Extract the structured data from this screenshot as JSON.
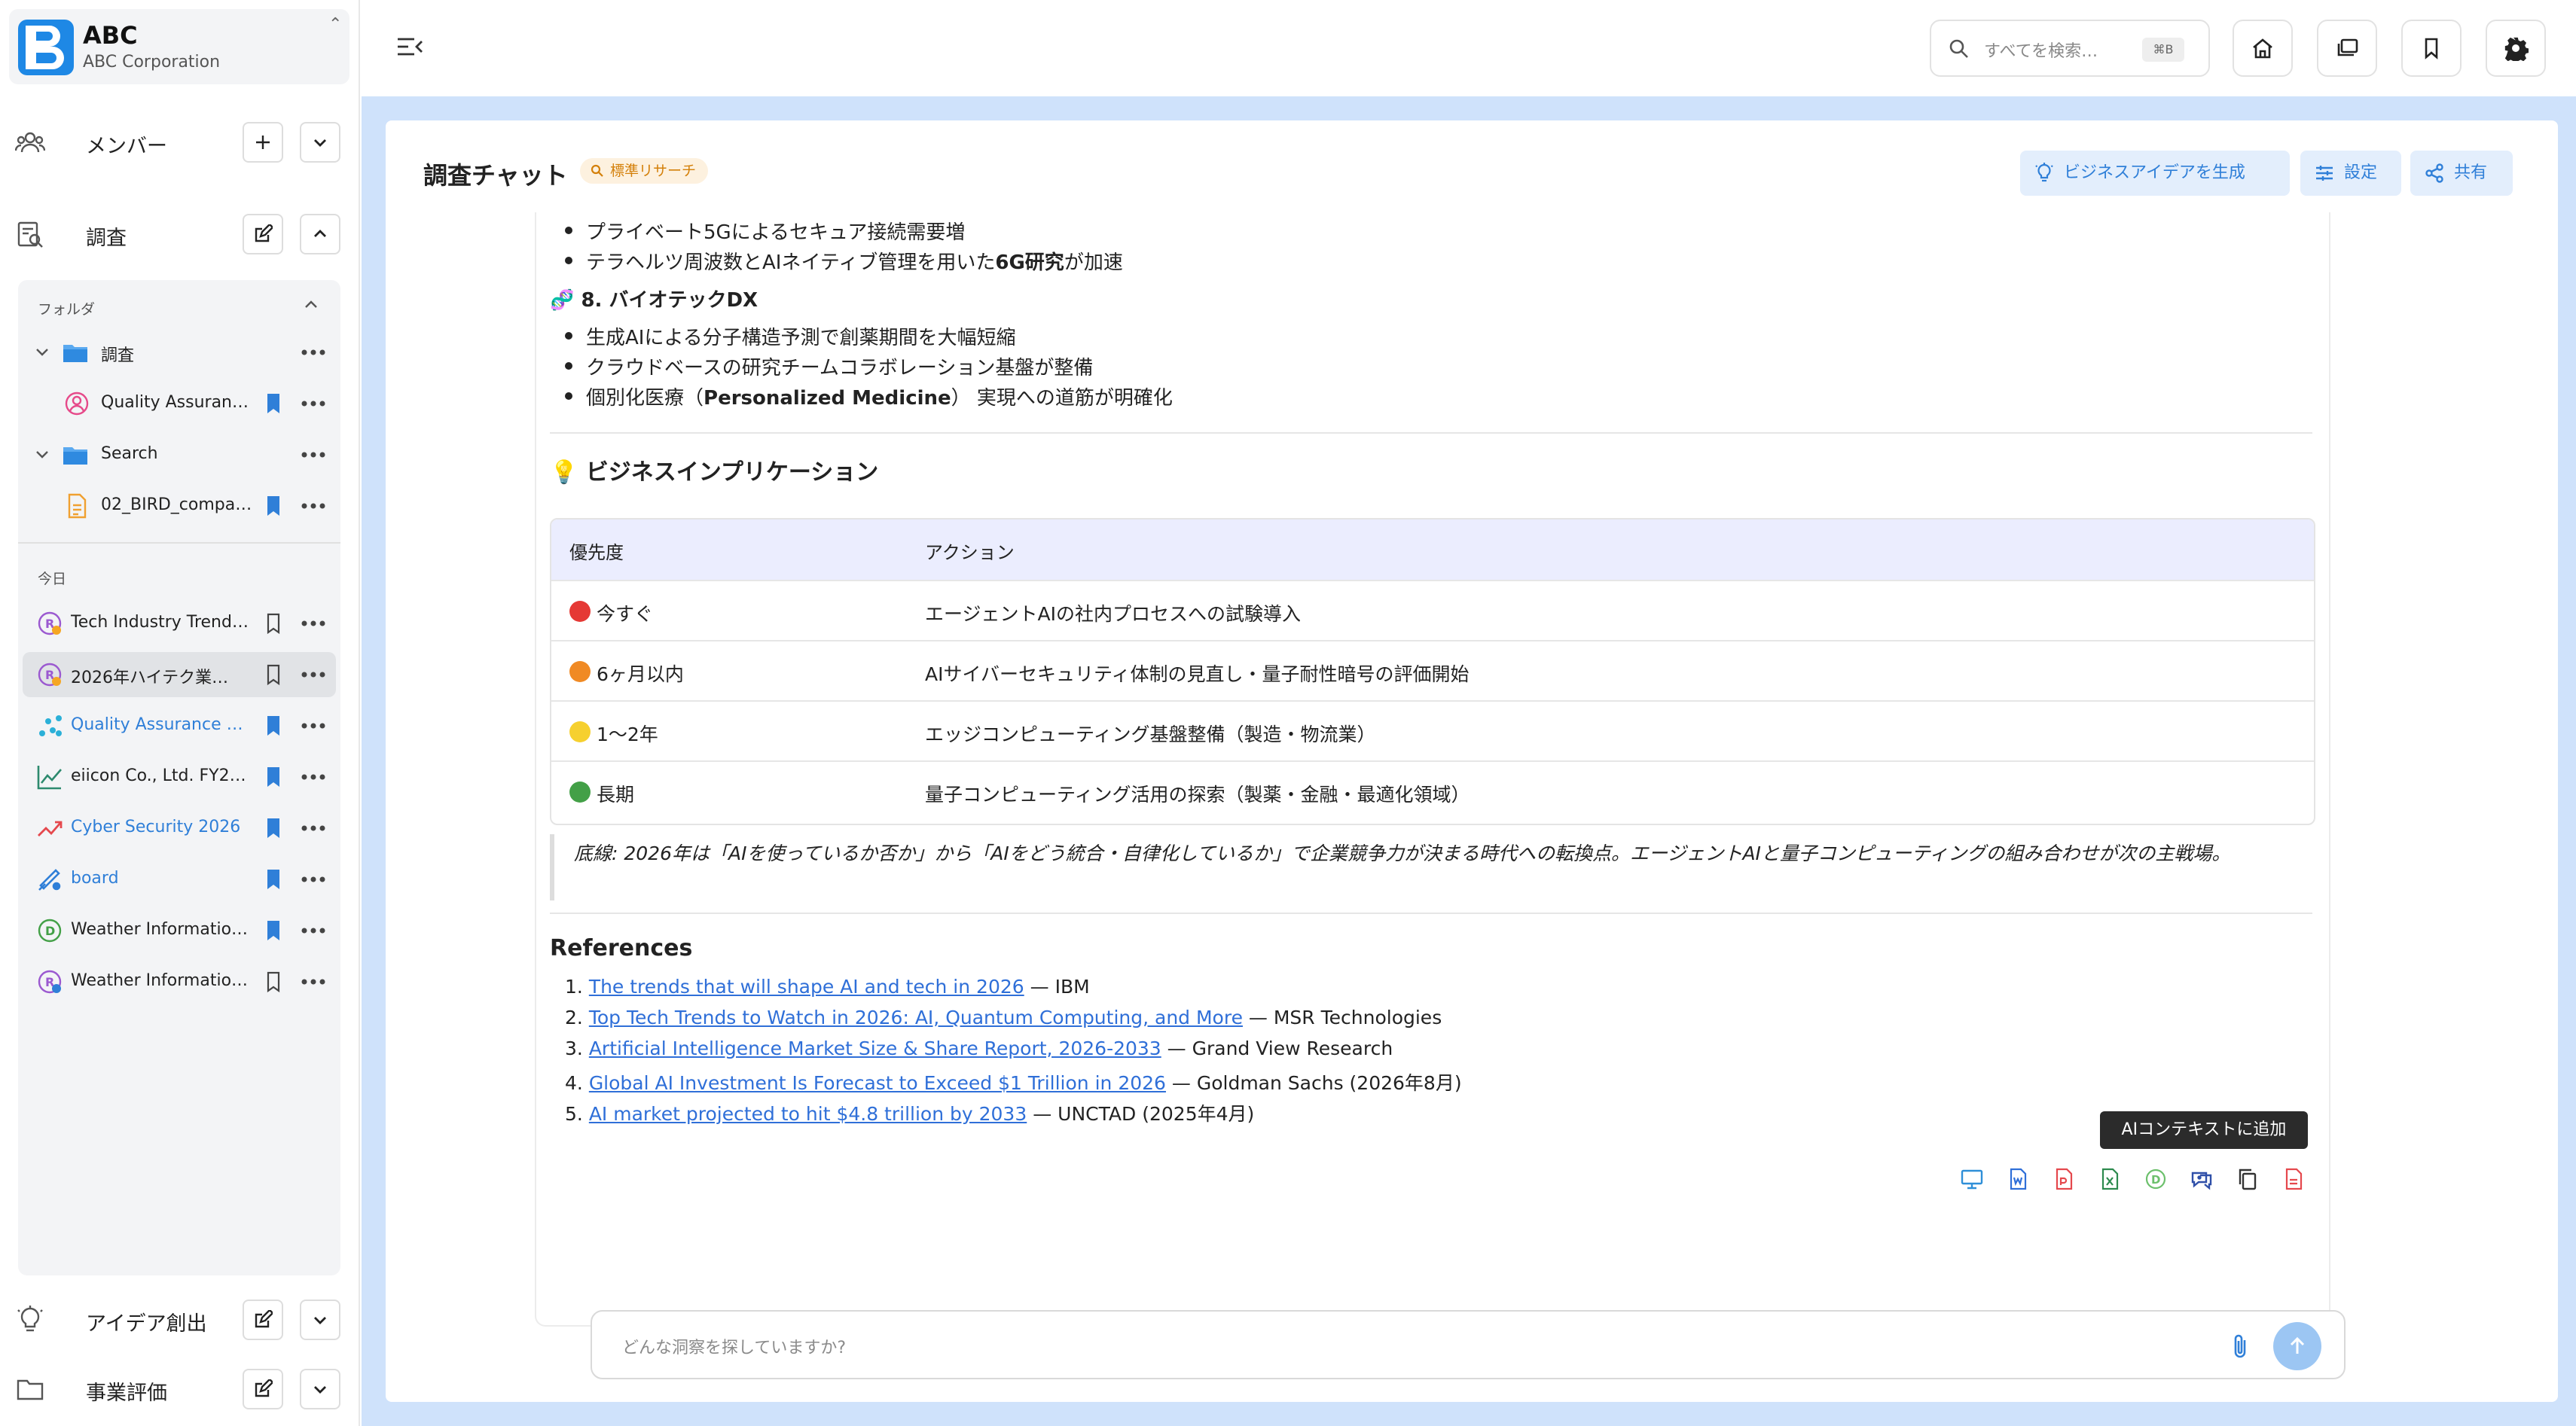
{
  "brand": {
    "name": "ABC",
    "subtitle": "ABC Corporation"
  },
  "sidebar": {
    "members_label": "メンバー",
    "research_label": "調査",
    "folders_header": "フォルダ",
    "folder1": {
      "name": "調査",
      "child": "Quality Assuranc…"
    },
    "folder2": {
      "name": "Search",
      "child": "02_BIRD_compa…"
    },
    "today_header": "今日",
    "items": [
      {
        "label": "Tech Industry Trend…",
        "icon": "research-chat-icon",
        "bookmarked": false
      },
      {
        "label": "2026年ハイテク業…",
        "icon": "research-chat-icon",
        "bookmarked": false
      },
      {
        "label": "Quality Assurance …",
        "icon": "scatter-icon",
        "bookmarked": true
      },
      {
        "label": "eiicon Co., Ltd. FY2…",
        "icon": "line-chart-icon",
        "bookmarked": true
      },
      {
        "label": "Cyber Security 2026",
        "icon": "trend-up-icon",
        "bookmarked": true
      },
      {
        "label": "board",
        "icon": "board-icon",
        "bookmarked": true
      },
      {
        "label": "Weather Informatio…",
        "icon": "d-circle-icon",
        "bookmarked": true
      },
      {
        "label": "Weather Informatio…",
        "icon": "research-chat-icon",
        "bookmarked": false
      }
    ],
    "ideas_label": "アイデア創出",
    "evaluation_label": "事業評価"
  },
  "topbar": {
    "search_placeholder": "すべてを検索…",
    "search_shortcut": "⌘B"
  },
  "chat": {
    "title": "調査チャット",
    "tag": "標準リサーチ",
    "btn_generate": "ビジネスアイデアを生成",
    "btn_settings": "設定",
    "btn_share": "共有"
  },
  "content": {
    "bullets_a": [
      "プライベート5Gによるセキュア接続需要増",
      "テラヘルツ周波数とAIネイティブ管理を用いた6G研究が加速"
    ],
    "section8_title": "8. バイオテックDX",
    "bullets_b": [
      "生成AIによる分子構造予測で創薬期間を大幅短縮",
      "クラウドベースの研究チームコラボレーション基盤が整備",
      "個別化医療（Personalized Medicine） 実現への道筋が明確化"
    ],
    "implication_title": "ビジネスインプリケーション",
    "table_headers": [
      "優先度",
      "アクション"
    ],
    "table_rows": [
      {
        "priority": "今すぐ",
        "action": "エージェントAIの社内プロセスへの試験導入",
        "color": "#e53935"
      },
      {
        "priority": "6ヶ月以内",
        "action": "AIサイバーセキュリティ体制の見直し・量子耐性暗号の評価開始",
        "color": "#f08a24"
      },
      {
        "priority": "1〜2年",
        "action": "エッジコンピューティング基盤整備（製造・物流業）",
        "color": "#f6d02f"
      },
      {
        "priority": "長期",
        "action": "量子コンピューティング活用の探索（製薬・金融・最適化領域）",
        "color": "#43a047"
      }
    ],
    "quote": "底線: 2026年は「AIを使っているか否か」から「AIをどう統合・自律化しているか」で企業競争力が決まる時代への転換点。エージェントAIと量子コンピューティングの組み合わせが次の主戦場。",
    "references_title": "References",
    "references": [
      {
        "num": "1.",
        "link": "The trends that will shape AI and tech in 2026",
        "source": " — IBM"
      },
      {
        "num": "2.",
        "link": "Top Tech Trends to Watch in 2026: AI, Quantum Computing, and More",
        "source": " — MSR Technologies"
      },
      {
        "num": "3.",
        "link": "Artificial Intelligence Market Size & Share Report, 2026-2033",
        "source": " — Grand View Research"
      },
      {
        "num": "4.",
        "link": "Global AI Investment Is Forecast to Exceed $1 Trillion in 2026",
        "source": " — Goldman Sachs (2026年8月)"
      },
      {
        "num": "5.",
        "link": "AI market projected to hit $4.8 trillion by 2033",
        "source": " — UNCTAD (2025年4月)"
      }
    ],
    "tooltip": "AIコンテキストに追加"
  },
  "composer": {
    "placeholder": "どんな洞察を探していますか?"
  }
}
